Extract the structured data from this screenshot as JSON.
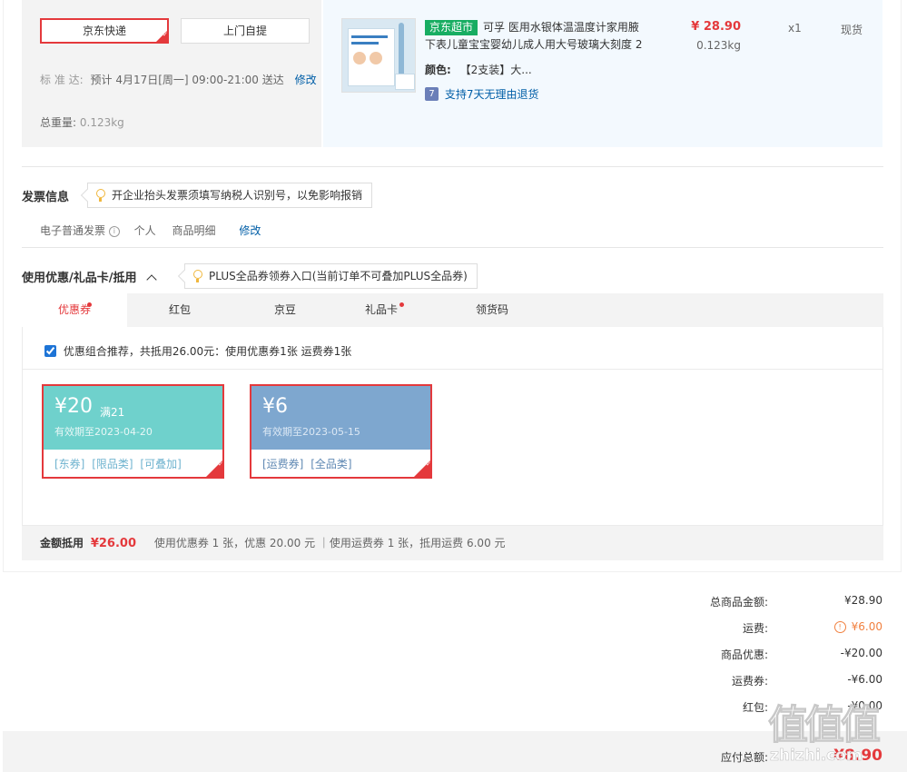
{
  "shipping": {
    "options": [
      {
        "label": "京东快递",
        "selected": true
      },
      {
        "label": "上门自提",
        "selected": false
      }
    ],
    "standard_prefix": "标 准 达:",
    "standard_text": "预计 4月17日[周一] 09:00-21:00 送达",
    "modify_label": "修改",
    "weight_label": "总重量:",
    "weight_value": "0.123kg"
  },
  "product": {
    "badge": "京东超市",
    "title_line1": "可孚 医用水银体温温度计家用腋",
    "title_line2": "下表儿童宝宝婴幼儿成人用大号玻璃大刻度 2",
    "color_label": "颜色:",
    "color_value": "【2支装】大...",
    "return_icon_text": "7",
    "return_policy": "支持7天无理由退货",
    "price": "¥ 28.90",
    "weight": "0.123kg",
    "quantity": "x1",
    "stock": "现货"
  },
  "invoice": {
    "title": "发票信息",
    "tip": "开企业抬头发票须填写纳税人识别号，以免影响报销",
    "type": "电子普通发票",
    "holder": "个人",
    "content": "商品明细",
    "modify_label": "修改"
  },
  "discount": {
    "title": "使用优惠/礼品卡/抵用",
    "tip": "PLUS全品券领券入口(当前订单不可叠加PLUS全品券)",
    "tabs": [
      {
        "label": "优惠券",
        "dot": true,
        "active": true
      },
      {
        "label": "红包",
        "dot": false,
        "active": false
      },
      {
        "label": "京豆",
        "dot": false,
        "active": false
      },
      {
        "label": "礼品卡",
        "dot": true,
        "active": false
      },
      {
        "label": "领货码",
        "dot": false,
        "active": false
      }
    ],
    "recommend_checked": true,
    "recommend_text": "优惠组合推荐，共抵用26.00元：使用优惠券1张 运费券1张",
    "coupons": [
      {
        "amount": "¥20",
        "condition": "满21",
        "expiry": "有效期至2023-04-20",
        "tags": [
          "[东券]",
          "[限品类]",
          "[可叠加]"
        ],
        "color": "#6fd1cc",
        "selected": true
      },
      {
        "amount": "¥6",
        "condition": "",
        "expiry": "有效期至2023-05-15",
        "tags": [
          "[运费券]",
          "[全品类]"
        ],
        "color": "#7ea7cf",
        "selected": true
      }
    ],
    "summary_label": "金额抵用",
    "summary_amount": "¥26.00",
    "summary_detail": "使用优惠券 1 张，优惠 20.00 元 ｜使用运费券 1 张，抵用运费 6.00 元"
  },
  "totals": {
    "rows": [
      {
        "label": "总商品金额:",
        "value": "¥28.90"
      },
      {
        "label": "运费:",
        "value": "¥6.00"
      },
      {
        "label": "商品优惠:",
        "value": "-¥20.00"
      },
      {
        "label": "运费券:",
        "value": "-¥6.00"
      },
      {
        "label": "红包:",
        "value": "-¥0.00"
      }
    ],
    "payable_label": "应付总额:",
    "payable_value": "¥8.90"
  },
  "watermark": {
    "glyphs": "值值值",
    "site": "zhizhi.com"
  },
  "colors": {
    "accent": "#e4393c",
    "link": "#005ea7",
    "badge": "#18ad62",
    "orange": "#e4393c"
  }
}
